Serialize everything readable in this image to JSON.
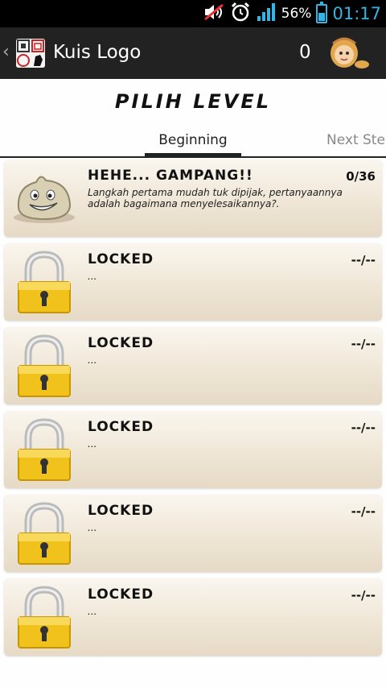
{
  "status_bar": {
    "battery_percent": "56%",
    "time": "01:17",
    "accent_color": "#35b5e5",
    "icons": [
      "mute-icon",
      "alarm-icon",
      "signal-icon",
      "battery-icon"
    ]
  },
  "action_bar": {
    "title": "Kuis Logo",
    "score": "0",
    "icons": [
      "back-chevron-icon",
      "app-logo-icon",
      "avatar-icon"
    ]
  },
  "page": {
    "title": "PILIH LEVEL"
  },
  "tabs": [
    {
      "label": "Beginning",
      "selected": true
    },
    {
      "label": "Next Step",
      "selected": false
    }
  ],
  "levels": [
    {
      "title": "HEHE...  GAMPANG!!",
      "score": "0/36",
      "description": "Langkah pertama mudah tuk dipijak, pertanyaannya adalah bagaimana menyelesaikannya?.",
      "icon": "smiling-blob-icon",
      "locked": false
    },
    {
      "title": "LOCKED",
      "score": "--/--",
      "description": "...",
      "icon": "padlock-icon",
      "locked": true
    },
    {
      "title": "LOCKED",
      "score": "--/--",
      "description": "...",
      "icon": "padlock-icon",
      "locked": true
    },
    {
      "title": "LOCKED",
      "score": "--/--",
      "description": "...",
      "icon": "padlock-icon",
      "locked": true
    },
    {
      "title": "LOCKED",
      "score": "--/--",
      "description": "...",
      "icon": "padlock-icon",
      "locked": true
    },
    {
      "title": "LOCKED",
      "score": "--/--",
      "description": "...",
      "icon": "padlock-icon",
      "locked": true
    }
  ]
}
